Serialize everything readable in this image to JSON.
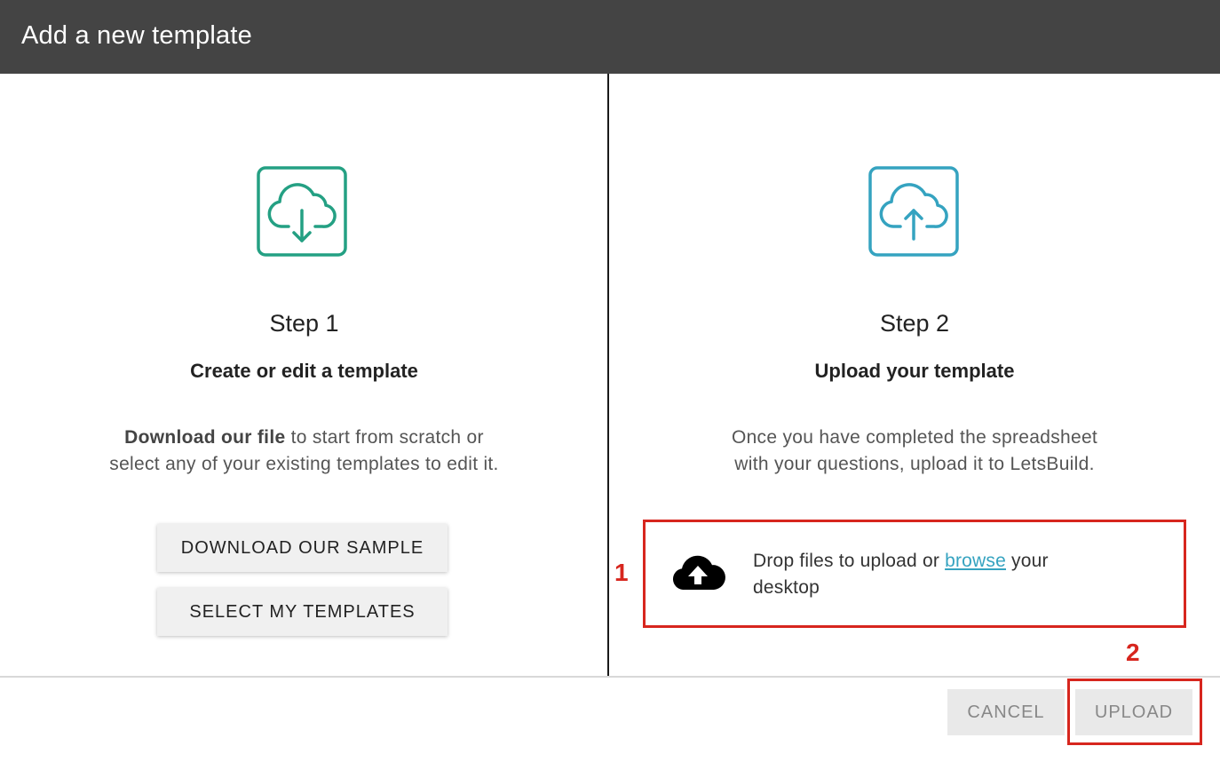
{
  "dialog": {
    "title": "Add a new template"
  },
  "step1": {
    "icon": "cloud-download-icon",
    "icon_color": "#24a083",
    "title": "Step 1",
    "subtitle": "Create or edit a template",
    "desc_bold": "Download our file",
    "desc_rest_line1": " to start from scratch or",
    "desc_line2": "select any of your existing templates to edit it.",
    "download_button": "DOWNLOAD OUR SAMPLE",
    "select_button": "SELECT MY TEMPLATES"
  },
  "step2": {
    "icon": "cloud-upload-icon",
    "icon_color": "#35a3c0",
    "title": "Step 2",
    "subtitle": "Upload your template",
    "desc_line1": "Once you have completed the spreadsheet",
    "desc_line2": "with your questions, upload it to LetsBuild.",
    "dropzone": {
      "icon": "cloud-upload-filled-icon",
      "text_before": "Drop files to upload or ",
      "link": "browse",
      "text_after_line1": " your",
      "text_line2": "desktop"
    }
  },
  "annotations": {
    "one": "1",
    "two": "2",
    "color": "#d7261e"
  },
  "footer": {
    "cancel_label": "CANCEL",
    "upload_label": "UPLOAD"
  }
}
